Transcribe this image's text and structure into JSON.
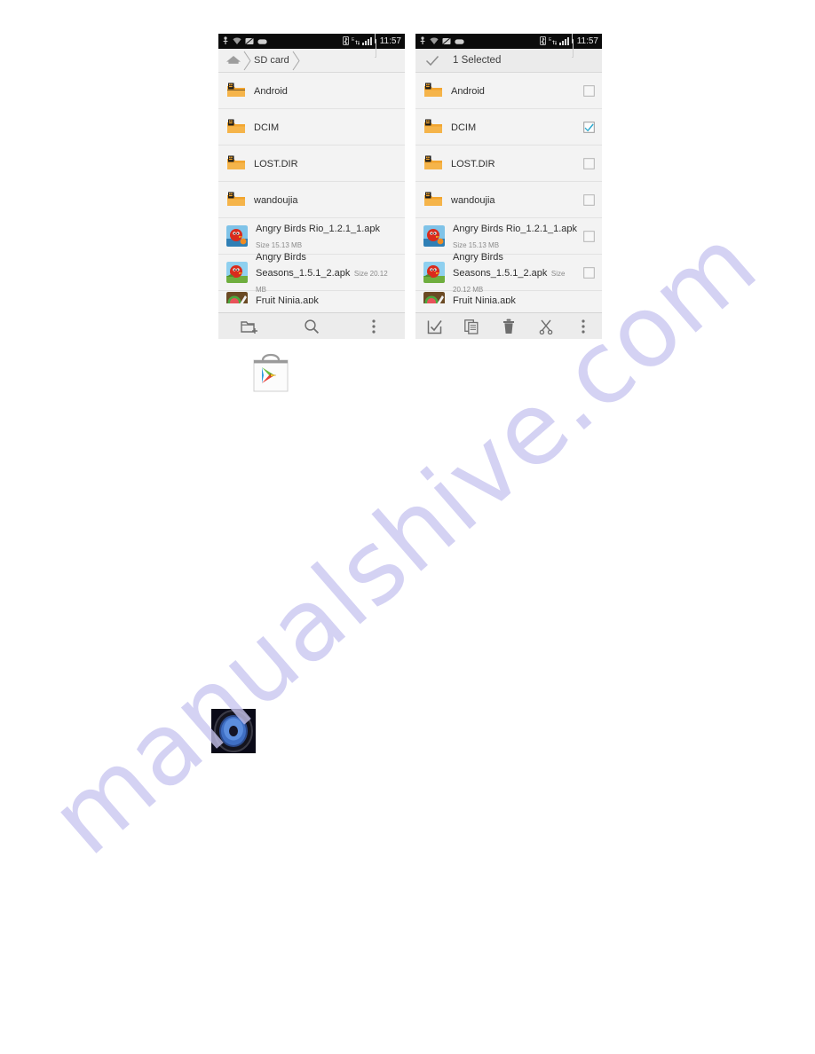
{
  "watermark": {
    "text": "manualshive.com",
    "color": "#c9c6f0"
  },
  "theme": {
    "statusbar_bg": "#0b0b0b",
    "list_bg": "#f3f3f3",
    "header_bg": "#f0f0f0",
    "select_header_bg": "#ebebeb",
    "toolbar_bg": "#ececec",
    "folder_accent": "#f0a22e",
    "checkbox_checked": "#2aa9cf",
    "text_primary": "#2f2f2f",
    "text_secondary": "#8a8a8a"
  },
  "phones": [
    {
      "id": "file-browser",
      "statusbar": {
        "time": "11:57",
        "left_icons": [
          "usb-debug-icon",
          "wifi-icon",
          "screenshot-icon",
          "message-icon"
        ],
        "right_icons": [
          "bluetooth-icon",
          "data-transfer-icon",
          "signal-bars-icon",
          "battery-icon"
        ]
      },
      "header": {
        "type": "breadcrumb",
        "home_icon": "home-icon",
        "crumbs": [
          "SD card"
        ]
      },
      "rows": [
        {
          "icon": "folder-icon",
          "title": "Android",
          "size": "",
          "type": "folder",
          "checkbox": false,
          "checked": false
        },
        {
          "icon": "folder-icon",
          "title": "DCIM",
          "size": "",
          "type": "folder",
          "checkbox": false,
          "checked": false
        },
        {
          "icon": "folder-icon",
          "title": "LOST.DIR",
          "size": "",
          "type": "folder",
          "checkbox": false,
          "checked": false
        },
        {
          "icon": "folder-icon",
          "title": "wandoujia",
          "size": "",
          "type": "folder",
          "checkbox": false,
          "checked": false
        },
        {
          "icon": "angry-birds-rio-icon",
          "title": "Angry Birds Rio_1.2.1_1.apk",
          "size": "Size 15.13 MB",
          "type": "file",
          "checkbox": false,
          "checked": false
        },
        {
          "icon": "angry-birds-seasons-icon",
          "title": "Angry Birds Seasons_1.5.1_2.apk",
          "size": "Size 20.12 MB",
          "type": "file",
          "checkbox": false,
          "checked": false
        },
        {
          "icon": "fruit-ninja-icon",
          "title": "Fruit Ninja.apk",
          "size": "",
          "type": "file-partial",
          "checkbox": false,
          "checked": false
        }
      ],
      "toolbar": [
        {
          "name": "new-folder-button",
          "label": "New folder"
        },
        {
          "name": "search-button",
          "label": "Search"
        },
        {
          "name": "overflow-menu-button",
          "label": "More options"
        }
      ]
    },
    {
      "id": "file-browser-selection",
      "statusbar": {
        "time": "11:57",
        "left_icons": [
          "usb-debug-icon",
          "wifi-icon",
          "screenshot-icon",
          "message-icon"
        ],
        "right_icons": [
          "bluetooth-icon",
          "data-transfer-icon",
          "signal-bars-icon",
          "battery-icon"
        ]
      },
      "header": {
        "type": "selection",
        "check_icon": "check-icon",
        "title": "1 Selected"
      },
      "rows": [
        {
          "icon": "folder-icon",
          "title": "Android",
          "size": "",
          "type": "folder",
          "checkbox": true,
          "checked": false
        },
        {
          "icon": "folder-icon",
          "title": "DCIM",
          "size": "",
          "type": "folder",
          "checkbox": true,
          "checked": true
        },
        {
          "icon": "folder-icon",
          "title": "LOST.DIR",
          "size": "",
          "type": "folder",
          "checkbox": true,
          "checked": false
        },
        {
          "icon": "folder-icon",
          "title": "wandoujia",
          "size": "",
          "type": "folder",
          "checkbox": true,
          "checked": false
        },
        {
          "icon": "angry-birds-rio-icon",
          "title": "Angry Birds Rio_1.2.1_1.apk",
          "size": "Size 15.13 MB",
          "type": "file",
          "checkbox": true,
          "checked": false
        },
        {
          "icon": "angry-birds-seasons-icon",
          "title": "Angry Birds Seasons_1.5.1_2.apk",
          "size": "Size 20.12 MB",
          "type": "file",
          "checkbox": true,
          "checked": false
        },
        {
          "icon": "fruit-ninja-icon",
          "title": "Fruit Ninja.apk",
          "size": "",
          "type": "file-partial",
          "checkbox": false,
          "checked": false
        }
      ],
      "toolbar": [
        {
          "name": "select-all-button",
          "label": "Select all"
        },
        {
          "name": "copy-button",
          "label": "Copy"
        },
        {
          "name": "delete-button",
          "label": "Delete"
        },
        {
          "name": "cut-button",
          "label": "Cut"
        },
        {
          "name": "overflow-menu-button",
          "label": "More options"
        }
      ]
    }
  ],
  "page_icons": [
    {
      "name": "play-store-icon",
      "label": "Play Store"
    },
    {
      "name": "audio-player-icon",
      "label": "Audio Player"
    }
  ]
}
